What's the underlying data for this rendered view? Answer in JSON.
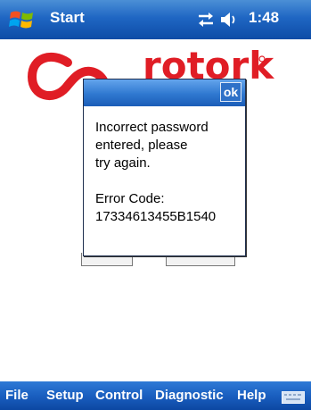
{
  "titlebar": {
    "title": "Start",
    "clock": "1:48"
  },
  "icons": {
    "start": "windows-flag-icon",
    "sync": "sync-arrows-icon",
    "volume": "speaker-icon",
    "keyboard": "keyboard-icon"
  },
  "brand": {
    "name": "rotork",
    "accent": "#e01d25"
  },
  "dialog": {
    "ok_label": "ok",
    "line1": "Incorrect password",
    "line2": "entered, please",
    "line3": "try again.",
    "error_label": "Error Code:",
    "error_code": "17334613455B1540"
  },
  "menu": {
    "file": "File",
    "setup": "Setup",
    "control": "Control",
    "diagnostic": "Diagnostic",
    "help": "Help"
  }
}
